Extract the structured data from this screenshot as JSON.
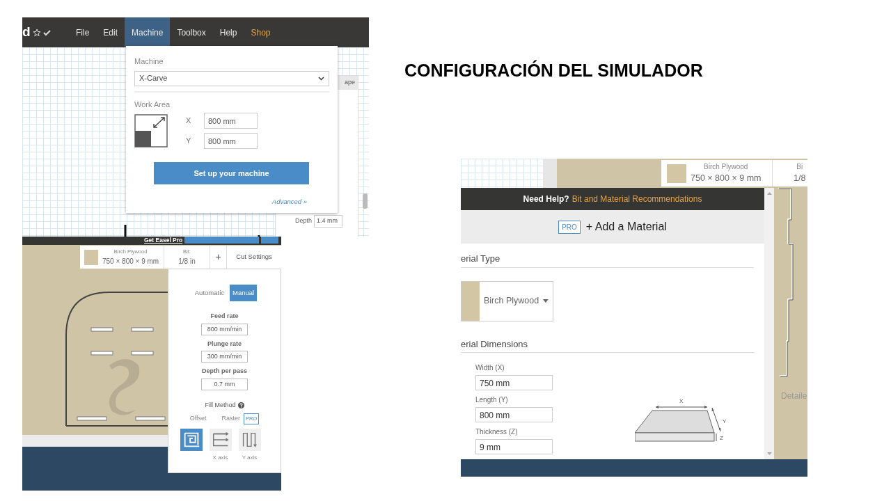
{
  "slide_title": "CONFIGURACIÓN DEL SIMULADOR",
  "machine_screen": {
    "app_title": "d",
    "menu": [
      {
        "label": "File",
        "selected": false,
        "highlighted": false
      },
      {
        "label": "Edit",
        "selected": false,
        "highlighted": false
      },
      {
        "label": "Machine",
        "selected": true,
        "highlighted": false
      },
      {
        "label": "Toolbox",
        "selected": false,
        "highlighted": false
      },
      {
        "label": "Help",
        "selected": false,
        "highlighted": false
      },
      {
        "label": "Shop",
        "selected": false,
        "highlighted": true
      }
    ],
    "machine_menu": {
      "machine_label": "Machine",
      "machine_select": "X-Carve",
      "work_area_label": "Work Area",
      "x_label": "X",
      "x_value": "800 mm",
      "y_label": "Y",
      "y_value": "800 mm",
      "setup_button": "Set up your machine",
      "advanced_link": "Advanced »"
    },
    "side_panel": {
      "header": "ape",
      "depth_label": "Depth",
      "depth_value": "1.4 mm"
    }
  },
  "cut_settings_screen": {
    "get_pro_link": "Get Easel Pro",
    "toolbar": {
      "material_name": "Birch Plywood",
      "material_size": "750 × 800 × 9 mm",
      "bit_label": "Bit:",
      "bit_value": "1/8 in",
      "add_button": "+",
      "cut_settings_button": "Cut Settings"
    },
    "modes": [
      {
        "label": "Automatic",
        "selected": false
      },
      {
        "label": "Manual",
        "selected": true
      }
    ],
    "fields": [
      {
        "label": "Feed rate",
        "value": "800 mm/min"
      },
      {
        "label": "Plunge rate",
        "value": "300 mm/min"
      },
      {
        "label": "Depth per pass",
        "value": "0.7 mm"
      }
    ],
    "fill_method_label": "Fill Method",
    "fill_groups": [
      {
        "label": "Offset"
      },
      {
        "label": "Raster",
        "badge": "PRO"
      }
    ],
    "fill_options": [
      {
        "kind": "offset",
        "selected": true
      },
      {
        "kind": "x_axis",
        "caption": "X axis",
        "selected": false
      },
      {
        "kind": "y_axis",
        "caption": "Y axis",
        "selected": false
      }
    ]
  },
  "material_screen": {
    "toolbar": {
      "material_name": "Birch Plywood",
      "material_size": "750 × 800 × 9 mm",
      "bit_label": "Bi",
      "bit_value": "1/8"
    },
    "canvas_label": "Detaile",
    "modal": {
      "help_text": "Need Help?",
      "help_link": "Bit and Material Recommendations",
      "pro_badge": "PRO",
      "add_material": "+ Add a Material",
      "type_heading": "erial Type",
      "material_select": "Birch Plywood",
      "dimensions_heading": "erial Dimensions",
      "fields": [
        {
          "label": "Width (X)",
          "value": "750 mm"
        },
        {
          "label": "Length (Y)",
          "value": "800 mm"
        },
        {
          "label": "Thickness (Z)",
          "value": "9 mm"
        }
      ],
      "diagram_labels": {
        "x": "X",
        "y": "Y",
        "z": "Z"
      }
    }
  }
}
